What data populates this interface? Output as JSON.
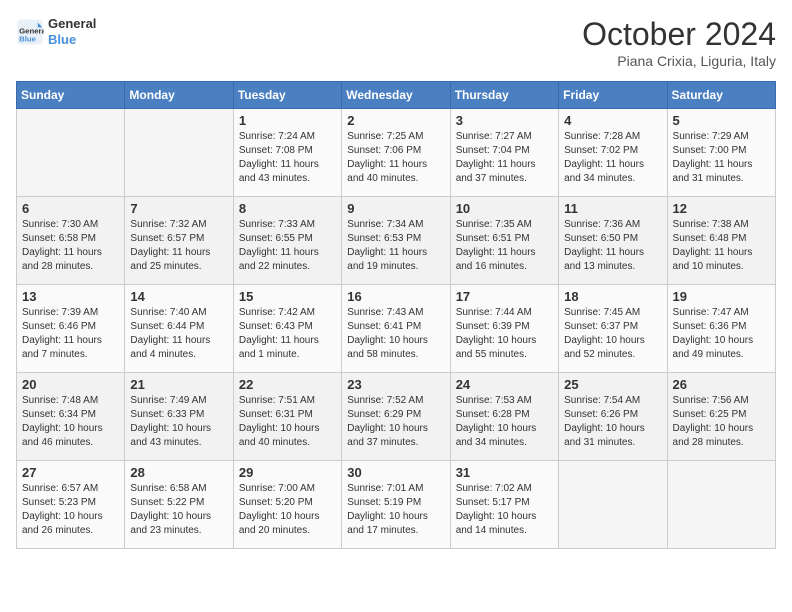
{
  "header": {
    "logo_line1": "General",
    "logo_line2": "Blue",
    "title": "October 2024",
    "location": "Piana Crixia, Liguria, Italy"
  },
  "columns": [
    "Sunday",
    "Monday",
    "Tuesday",
    "Wednesday",
    "Thursday",
    "Friday",
    "Saturday"
  ],
  "weeks": [
    [
      {
        "day": "",
        "info": ""
      },
      {
        "day": "",
        "info": ""
      },
      {
        "day": "1",
        "info": "Sunrise: 7:24 AM\nSunset: 7:08 PM\nDaylight: 11 hours and 43 minutes."
      },
      {
        "day": "2",
        "info": "Sunrise: 7:25 AM\nSunset: 7:06 PM\nDaylight: 11 hours and 40 minutes."
      },
      {
        "day": "3",
        "info": "Sunrise: 7:27 AM\nSunset: 7:04 PM\nDaylight: 11 hours and 37 minutes."
      },
      {
        "day": "4",
        "info": "Sunrise: 7:28 AM\nSunset: 7:02 PM\nDaylight: 11 hours and 34 minutes."
      },
      {
        "day": "5",
        "info": "Sunrise: 7:29 AM\nSunset: 7:00 PM\nDaylight: 11 hours and 31 minutes."
      }
    ],
    [
      {
        "day": "6",
        "info": "Sunrise: 7:30 AM\nSunset: 6:58 PM\nDaylight: 11 hours and 28 minutes."
      },
      {
        "day": "7",
        "info": "Sunrise: 7:32 AM\nSunset: 6:57 PM\nDaylight: 11 hours and 25 minutes."
      },
      {
        "day": "8",
        "info": "Sunrise: 7:33 AM\nSunset: 6:55 PM\nDaylight: 11 hours and 22 minutes."
      },
      {
        "day": "9",
        "info": "Sunrise: 7:34 AM\nSunset: 6:53 PM\nDaylight: 11 hours and 19 minutes."
      },
      {
        "day": "10",
        "info": "Sunrise: 7:35 AM\nSunset: 6:51 PM\nDaylight: 11 hours and 16 minutes."
      },
      {
        "day": "11",
        "info": "Sunrise: 7:36 AM\nSunset: 6:50 PM\nDaylight: 11 hours and 13 minutes."
      },
      {
        "day": "12",
        "info": "Sunrise: 7:38 AM\nSunset: 6:48 PM\nDaylight: 11 hours and 10 minutes."
      }
    ],
    [
      {
        "day": "13",
        "info": "Sunrise: 7:39 AM\nSunset: 6:46 PM\nDaylight: 11 hours and 7 minutes."
      },
      {
        "day": "14",
        "info": "Sunrise: 7:40 AM\nSunset: 6:44 PM\nDaylight: 11 hours and 4 minutes."
      },
      {
        "day": "15",
        "info": "Sunrise: 7:42 AM\nSunset: 6:43 PM\nDaylight: 11 hours and 1 minute."
      },
      {
        "day": "16",
        "info": "Sunrise: 7:43 AM\nSunset: 6:41 PM\nDaylight: 10 hours and 58 minutes."
      },
      {
        "day": "17",
        "info": "Sunrise: 7:44 AM\nSunset: 6:39 PM\nDaylight: 10 hours and 55 minutes."
      },
      {
        "day": "18",
        "info": "Sunrise: 7:45 AM\nSunset: 6:37 PM\nDaylight: 10 hours and 52 minutes."
      },
      {
        "day": "19",
        "info": "Sunrise: 7:47 AM\nSunset: 6:36 PM\nDaylight: 10 hours and 49 minutes."
      }
    ],
    [
      {
        "day": "20",
        "info": "Sunrise: 7:48 AM\nSunset: 6:34 PM\nDaylight: 10 hours and 46 minutes."
      },
      {
        "day": "21",
        "info": "Sunrise: 7:49 AM\nSunset: 6:33 PM\nDaylight: 10 hours and 43 minutes."
      },
      {
        "day": "22",
        "info": "Sunrise: 7:51 AM\nSunset: 6:31 PM\nDaylight: 10 hours and 40 minutes."
      },
      {
        "day": "23",
        "info": "Sunrise: 7:52 AM\nSunset: 6:29 PM\nDaylight: 10 hours and 37 minutes."
      },
      {
        "day": "24",
        "info": "Sunrise: 7:53 AM\nSunset: 6:28 PM\nDaylight: 10 hours and 34 minutes."
      },
      {
        "day": "25",
        "info": "Sunrise: 7:54 AM\nSunset: 6:26 PM\nDaylight: 10 hours and 31 minutes."
      },
      {
        "day": "26",
        "info": "Sunrise: 7:56 AM\nSunset: 6:25 PM\nDaylight: 10 hours and 28 minutes."
      }
    ],
    [
      {
        "day": "27",
        "info": "Sunrise: 6:57 AM\nSunset: 5:23 PM\nDaylight: 10 hours and 26 minutes."
      },
      {
        "day": "28",
        "info": "Sunrise: 6:58 AM\nSunset: 5:22 PM\nDaylight: 10 hours and 23 minutes."
      },
      {
        "day": "29",
        "info": "Sunrise: 7:00 AM\nSunset: 5:20 PM\nDaylight: 10 hours and 20 minutes."
      },
      {
        "day": "30",
        "info": "Sunrise: 7:01 AM\nSunset: 5:19 PM\nDaylight: 10 hours and 17 minutes."
      },
      {
        "day": "31",
        "info": "Sunrise: 7:02 AM\nSunset: 5:17 PM\nDaylight: 10 hours and 14 minutes."
      },
      {
        "day": "",
        "info": ""
      },
      {
        "day": "",
        "info": ""
      }
    ]
  ]
}
